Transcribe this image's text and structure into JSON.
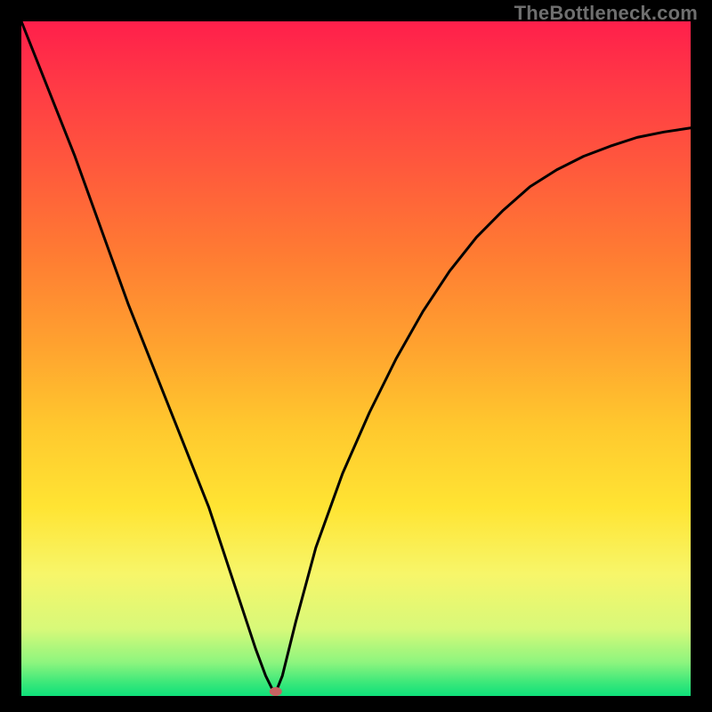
{
  "watermark": "TheBottleneck.com",
  "chart_data": {
    "type": "line",
    "title": "",
    "xlabel": "",
    "ylabel": "",
    "xlim": [
      0,
      100
    ],
    "ylim": [
      0,
      100
    ],
    "notch_x": 38,
    "notch_marker_color": "#c86262",
    "series": [
      {
        "name": "curve",
        "x": [
          0,
          4,
          8,
          12,
          16,
          20,
          24,
          28,
          31,
          33,
          35,
          36.5,
          37.5,
          38,
          39,
          41,
          44,
          48,
          52,
          56,
          60,
          64,
          68,
          72,
          76,
          80,
          84,
          88,
          92,
          96,
          100
        ],
        "values": [
          100,
          90,
          80,
          69,
          58,
          48,
          38,
          28,
          19,
          13,
          7,
          3,
          1,
          0.5,
          3,
          11,
          22,
          33,
          42,
          50,
          57,
          63,
          68,
          72,
          75.5,
          78,
          80,
          81.5,
          82.8,
          83.6,
          84.2
        ]
      }
    ],
    "gradient_colors": {
      "top": "#ff1f4b",
      "mid": "#ffe433",
      "bottom": "#0ee07a"
    }
  }
}
